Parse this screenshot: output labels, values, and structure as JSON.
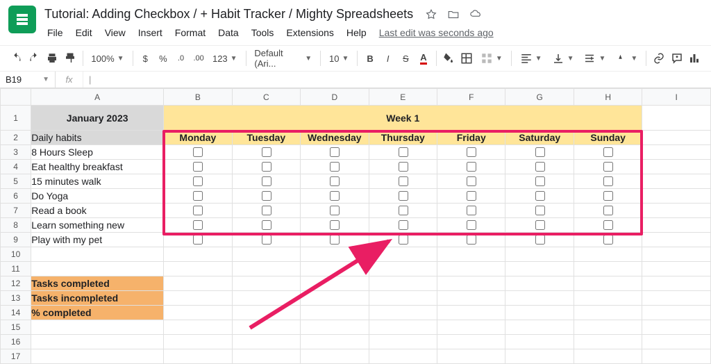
{
  "doc": {
    "title": "Tutorial: Adding Checkbox / + Habit Tracker / Mighty Spreadsheets",
    "last_edit": "Last edit was seconds ago"
  },
  "menus": [
    "File",
    "Edit",
    "View",
    "Insert",
    "Format",
    "Data",
    "Tools",
    "Extensions",
    "Help"
  ],
  "toolbar": {
    "zoom": "100%",
    "currency": "$",
    "percent": "%",
    "dec_dec": ".0",
    "dec_inc": ".00",
    "more_formats": "123",
    "font": "Default (Ari...",
    "font_size": "10",
    "bold": "B",
    "italic": "I",
    "strike": "S",
    "text_color": "A"
  },
  "namebox": "B19",
  "fx_label": "fx",
  "columns": [
    "A",
    "B",
    "C",
    "D",
    "E",
    "F",
    "G",
    "H",
    "I"
  ],
  "row_count": 17,
  "content": {
    "month": "January 2023",
    "week": "Week 1",
    "habits_header": "Daily habits",
    "days": [
      "Monday",
      "Tuesday",
      "Wednesday",
      "Thursday",
      "Friday",
      "Saturday",
      "Sunday"
    ],
    "habits": [
      "8 Hours Sleep",
      "Eat healthy breakfast",
      "15 minutes walk",
      "Do Yoga",
      "Read a book",
      "Learn something new",
      "Play with my pet"
    ],
    "stats": [
      "Tasks completed",
      "Tasks incompleted",
      "% completed"
    ]
  },
  "chart_data": {
    "type": "table",
    "title": "Week 1 Habit Tracker — January 2023",
    "columns": [
      "Monday",
      "Tuesday",
      "Wednesday",
      "Thursday",
      "Friday",
      "Saturday",
      "Sunday"
    ],
    "rows": [
      "8 Hours Sleep",
      "Eat healthy breakfast",
      "15 minutes walk",
      "Do Yoga",
      "Read a book",
      "Learn something new",
      "Play with my pet"
    ],
    "values": [
      [
        false,
        false,
        false,
        false,
        false,
        false,
        false
      ],
      [
        false,
        false,
        false,
        false,
        false,
        false,
        false
      ],
      [
        false,
        false,
        false,
        false,
        false,
        false,
        false
      ],
      [
        false,
        false,
        false,
        false,
        false,
        false,
        false
      ],
      [
        false,
        false,
        false,
        false,
        false,
        false,
        false
      ],
      [
        false,
        false,
        false,
        false,
        false,
        false,
        false
      ],
      [
        false,
        false,
        false,
        false,
        false,
        false,
        false
      ]
    ],
    "summary_rows": [
      "Tasks completed",
      "Tasks incompleted",
      "% completed"
    ]
  }
}
